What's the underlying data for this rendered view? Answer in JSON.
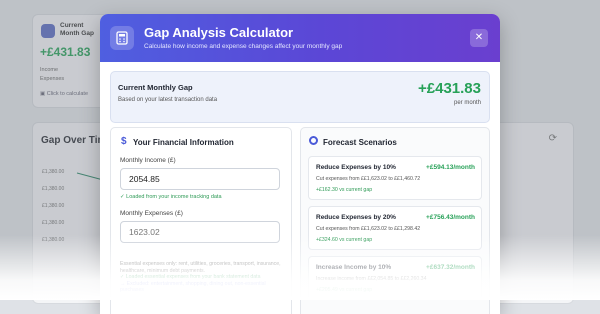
{
  "background": {
    "card": {
      "title_line1": "Current",
      "title_line2": "Month Gap",
      "amount": "+£431.83",
      "income_label": "Income",
      "expenses_label": "Expenses",
      "link": "Click to calculate"
    },
    "chart": {
      "title": "Gap Over Tim",
      "ticks": [
        "£1,380.00",
        "£1,380.00",
        "£1,380.00",
        "£1,380.00",
        "£1,380.00"
      ]
    }
  },
  "modal": {
    "title": "Gap Analysis Calculator",
    "subtitle": "Calculate how income and expense changes affect your monthly gap",
    "close_glyph": "✕",
    "current_gap": {
      "label": "Current Monthly Gap",
      "sublabel": "Based on your latest transaction data",
      "value": "+£431.83",
      "per": "per month"
    },
    "financial": {
      "icon": "$",
      "title": "Your Financial Information",
      "income_label": "Monthly Income (£)",
      "income_value": "2054.85",
      "income_note": "✓ Loaded from your income tracking data",
      "expenses_label": "Monthly Expenses (£)",
      "expenses_value": "1623.02",
      "description": "Essential expenses only: rent, utilities, groceries, transport, insurance, healthcare, minimum debt payments.",
      "expenses_note": "✓ Loaded essential expenses from your bank statement data",
      "excluded_note": "→ Excluded: entertainment, shopping, dining out, non-essential purchases"
    },
    "forecast": {
      "title": "Forecast Scenarios",
      "scenarios": [
        {
          "name": "Reduce Expenses by 10%",
          "value": "+£594.13/month",
          "desc": "Cut expenses from ££1,623.02 to ££1,460.72",
          "delta": "+£162.30 vs current gap"
        },
        {
          "name": "Reduce Expenses by 20%",
          "value": "+£756.43/month",
          "desc": "Cut expenses from ££1,623.02 to ££1,298.42",
          "delta": "+£324.60 vs current gap"
        },
        {
          "name": "Increase Income by 10%",
          "value": "+£637.32/month",
          "desc": "Increase income from ££2,054.85 to ££2,260.34",
          "delta": "+£205.49 vs current gap"
        }
      ]
    }
  },
  "colors": {
    "accent": "#5b47d6",
    "positive": "#27a158"
  },
  "icons": {
    "header": "calculator-icon",
    "close": "close-icon",
    "financial": "dollar-icon",
    "forecast": "target-icon",
    "refresh": "refresh-icon"
  }
}
